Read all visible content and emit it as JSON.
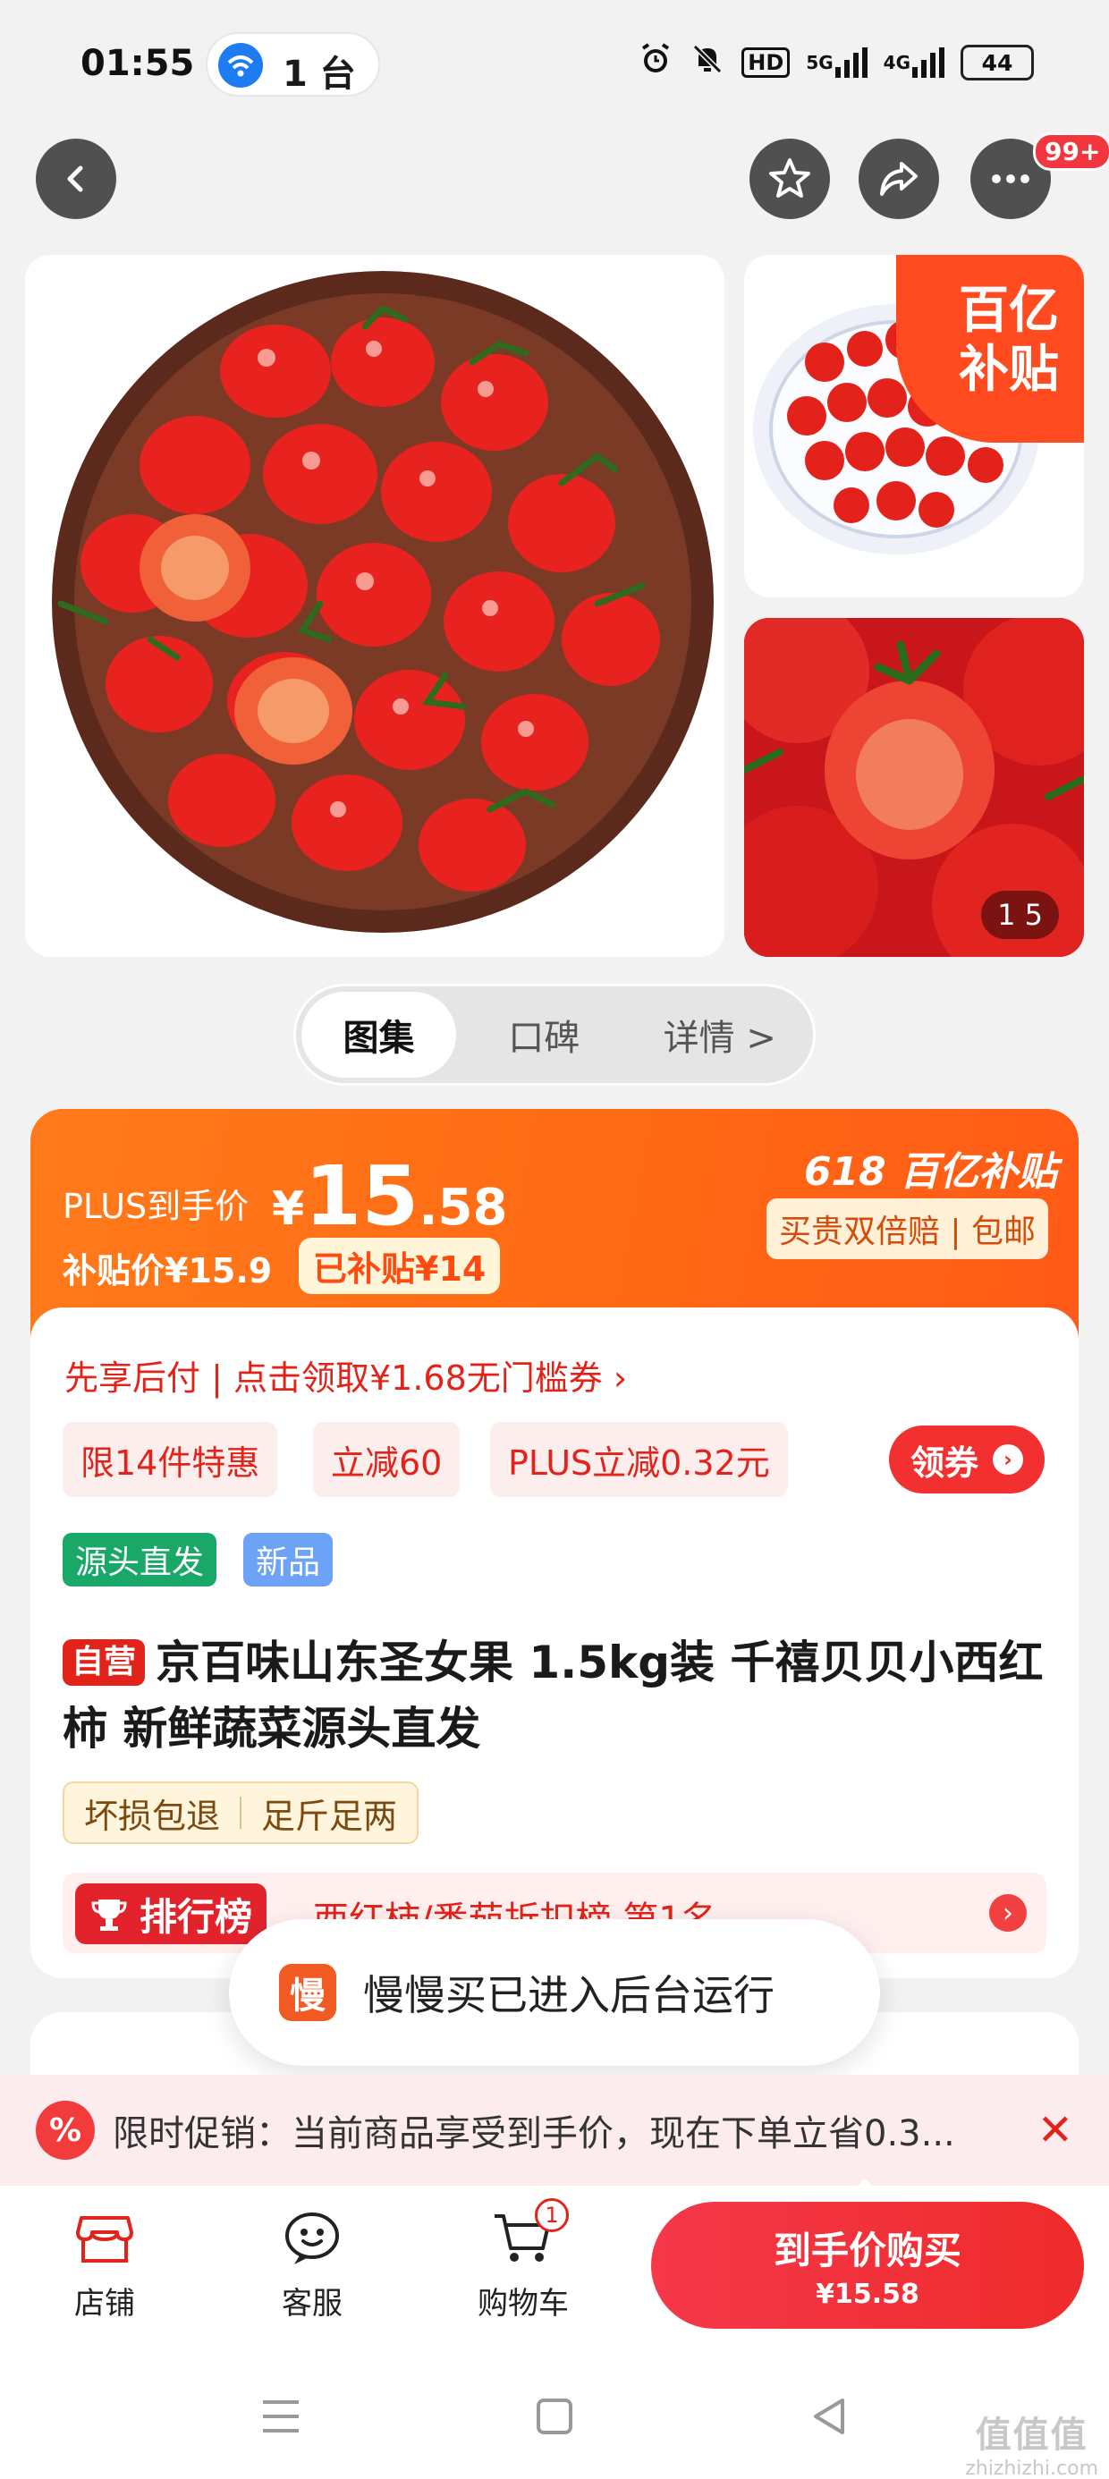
{
  "status_bar": {
    "time": "01:55",
    "cast_label": "1 台",
    "network_1": "5G",
    "network_2": "4G",
    "hd": "HD",
    "battery": "44"
  },
  "header": {
    "more_badge": "99+"
  },
  "gallery": {
    "subsidy_tag_line1": "百亿",
    "subsidy_tag_line2": "补贴",
    "counter_current": "1",
    "counter_total": "5"
  },
  "tabs": [
    {
      "label": "图集"
    },
    {
      "label": "口碑"
    },
    {
      "label": "详情 >"
    }
  ],
  "price": {
    "plus_label": "PLUS到手价",
    "yen": "¥",
    "integer": "15",
    "decimal": ".58",
    "subsidy_price": "补贴价¥15.9",
    "subsidized": "已补贴¥14",
    "promo_618": "618 百亿补贴",
    "guarantee": "买贵双倍赔 | 包邮"
  },
  "product": {
    "coupon_line": "先享后付 | 点击领取¥1.68无门槛券 ›",
    "chips": [
      "限14件特惠",
      "立减60",
      "PLUS立减0.32元"
    ],
    "claim_button": "领券",
    "tags": [
      "源头直发",
      "新品"
    ],
    "self_operated": "自营",
    "title": "京百味山东圣女果 1.5kg装 千禧贝贝小西红柿 新鲜蔬菜源头直发",
    "services": [
      "坏损包退",
      "足斤足两"
    ],
    "rank_badge": "排行榜",
    "rank_text": "西红柿/番茄折扣榜 第1名"
  },
  "toast": {
    "icon_char": "慢",
    "message": "慢慢买已进入后台运行"
  },
  "promo_strip": {
    "text": "限时促销：当前商品享受到手价，现在下单立省0.3..."
  },
  "bottom_bar": {
    "store": "店铺",
    "service": "客服",
    "cart": "购物车",
    "cart_count": "1",
    "buy_label": "到手价购买",
    "buy_price": "¥15.58"
  },
  "watermark": {
    "line1": "值值值",
    "line2": "zhizhizhi.com"
  },
  "colors": {
    "accent_red": "#e2231a",
    "price_orange": "#ff6a14",
    "tag_green": "#19a868",
    "tag_blue": "#6ca3f7"
  }
}
